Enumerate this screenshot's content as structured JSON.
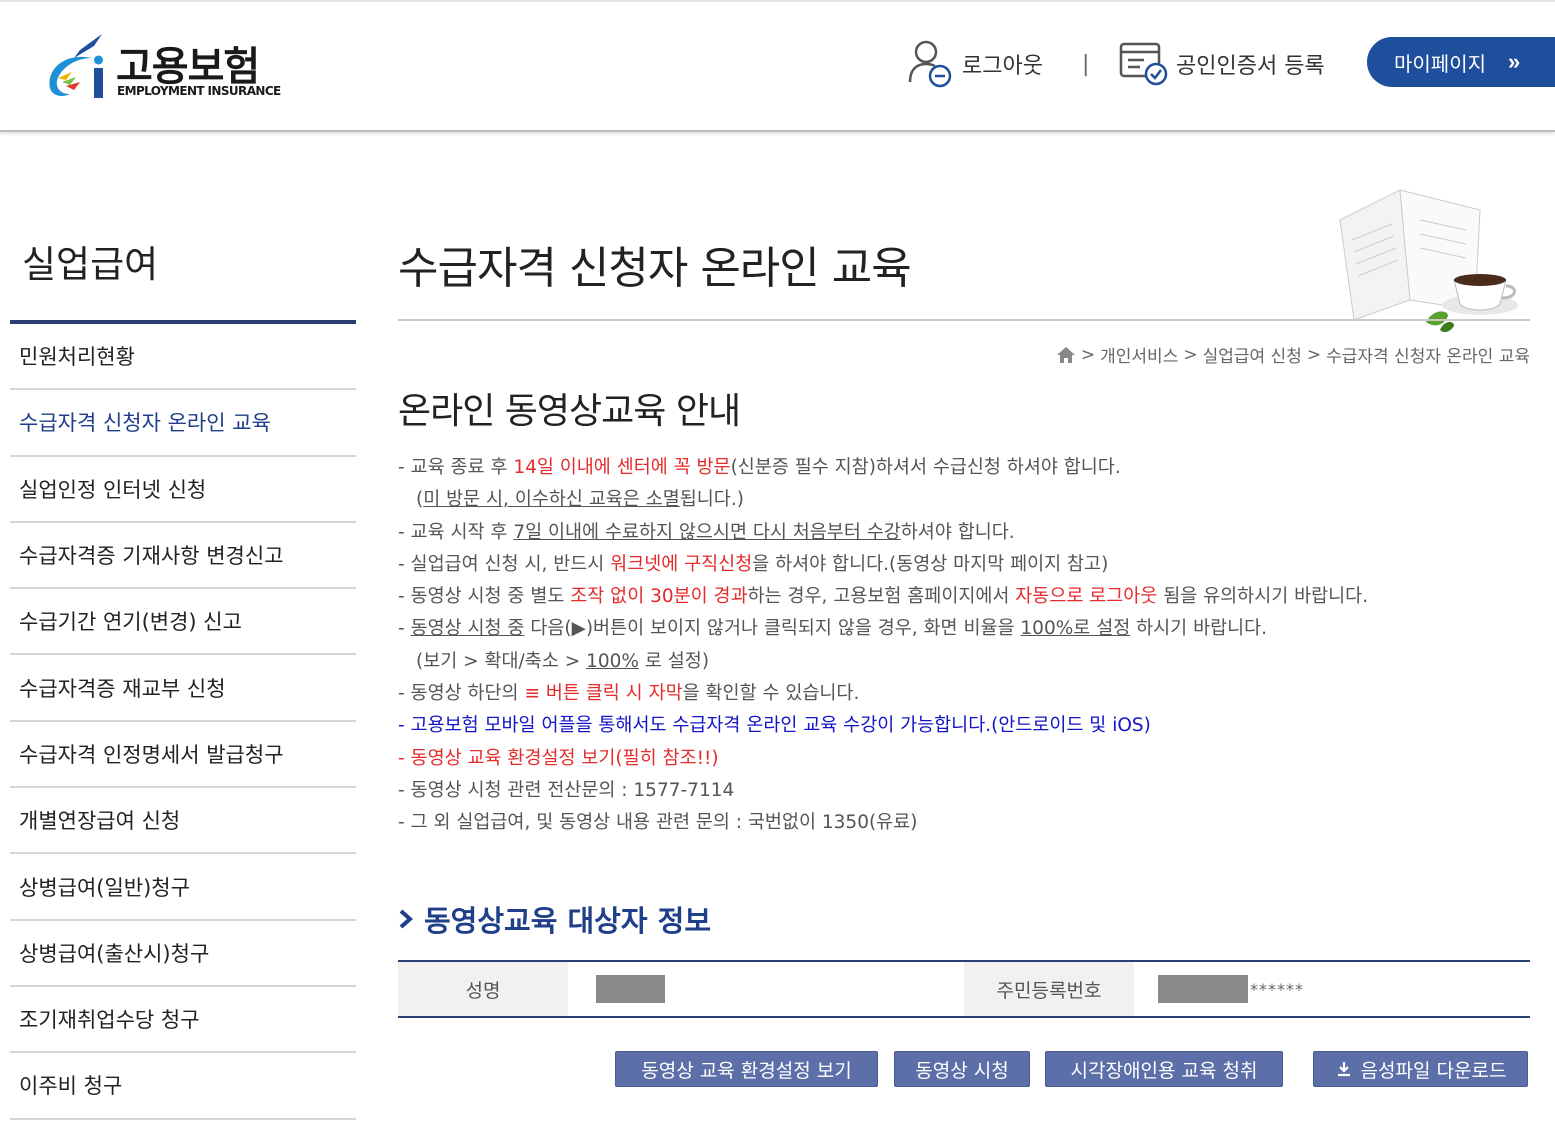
{
  "header": {
    "logo_title": "고용보험",
    "logo_sub": "EMPLOYMENT INSURANCE",
    "logout_label": "로그아웃",
    "separator": "|",
    "cert_label": "공인인증서 등록",
    "mypage_label": "마이페이지",
    "mypage_arrow": "»"
  },
  "sidebar": {
    "title": "실업급여",
    "items": [
      {
        "label": "민원처리현황"
      },
      {
        "label": "수급자격 신청자 온라인 교육"
      },
      {
        "label": "실업인정 인터넷 신청"
      },
      {
        "label": "수급자격증 기재사항 변경신고"
      },
      {
        "label": "수급기간 연기(변경) 신고"
      },
      {
        "label": "수급자격증 재교부 신청"
      },
      {
        "label": "수급자격 인정명세서 발급청구"
      },
      {
        "label": "개별연장급여 신청"
      },
      {
        "label": "상병급여(일반)청구"
      },
      {
        "label": "상병급여(출산시)청구"
      },
      {
        "label": "조기재취업수당 청구"
      },
      {
        "label": "이주비 청구"
      }
    ]
  },
  "main": {
    "title": "수급자격 신청자 온라인 교육",
    "breadcrumb": [
      "개인서비스",
      "실업급여 신청",
      "수급자격 신청자 온라인 교육"
    ],
    "breadcrumb_sep": ">",
    "section_title": "온라인 동영상교육 안내",
    "notice": {
      "l1a": "- 교육 종료 후 ",
      "l1b": "14일 이내에 센터에 꼭 방문",
      "l1c": "(신분증 필수 지참)하셔서 수급신청 하셔야 합니다.",
      "l2a": "(",
      "l2b": "미 방문 시, 이수하신 교육은 소멸",
      "l2c": "됩니다.)",
      "l3a": "- 교육 시작 후 ",
      "l3b": "7일 이내에 수료하지 않으시면 다시 처음부터 수강",
      "l3c": "하셔야 합니다.",
      "l4a": "- 실업급여 신청 시, 반드시 ",
      "l4b": "워크넷에 구직신청",
      "l4c": "을 하셔야 합니다.(동영상 마지막 페이지 참고)",
      "l5a": "- 동영상 시청 중 별도 ",
      "l5b": "조작 없이 30분이 경과",
      "l5c": "하는 경우, 고용보험 홈페이지에서 ",
      "l5d": "자동으로 로그아웃",
      "l5e": " 됨을 유의하시기 바랍니다.",
      "l6a": "- ",
      "l6b": "동영상 시청 중",
      "l6c": " 다음(▶)버튼이 보이지 않거나 클릭되지 않을 경우, 화면 비율을 ",
      "l6d": "100%로 설정",
      "l6e": " 하시기 바랍니다.",
      "l7a": "(보기 > 확대/축소 > ",
      "l7b": "100%",
      "l7c": " 로 설정)",
      "l8a": "- 동영상 하단의 ",
      "l8b": "≡ 버튼 클릭 시 자막",
      "l8c": "을 확인할 수 있습니다.",
      "l9": "- 고용보험 모바일 어플을 통해서도 수급자격 온라인 교육 수강이 가능합니다.(안드로이드 및 iOS)",
      "l10": "- 동영상 교육 환경설정 보기(필히 참조!!)",
      "l11": "- 동영상 시청 관련 전산문의 : 1577-7114",
      "l12": "- 그 외 실업급여, 및 동영상 내용 관련 문의 : 국번없이 1350(유료)"
    },
    "sub_title": "동영상교육 대상자 정보",
    "table": {
      "name_label": "성명",
      "rrn_label": "주민등록번호",
      "rrn_suffix": "******"
    },
    "buttons": {
      "env": "동영상 교육 환경설정 보기",
      "watch": "동영상 시청",
      "visual": "시각장애인용 교육 청취",
      "download": "음성파일 다운로드"
    }
  },
  "colors": {
    "primary": "#1f4e9c",
    "navy": "#2c3f73",
    "button": "#5d6fa8",
    "red": "#e52b2b",
    "blue": "#1414c8"
  }
}
